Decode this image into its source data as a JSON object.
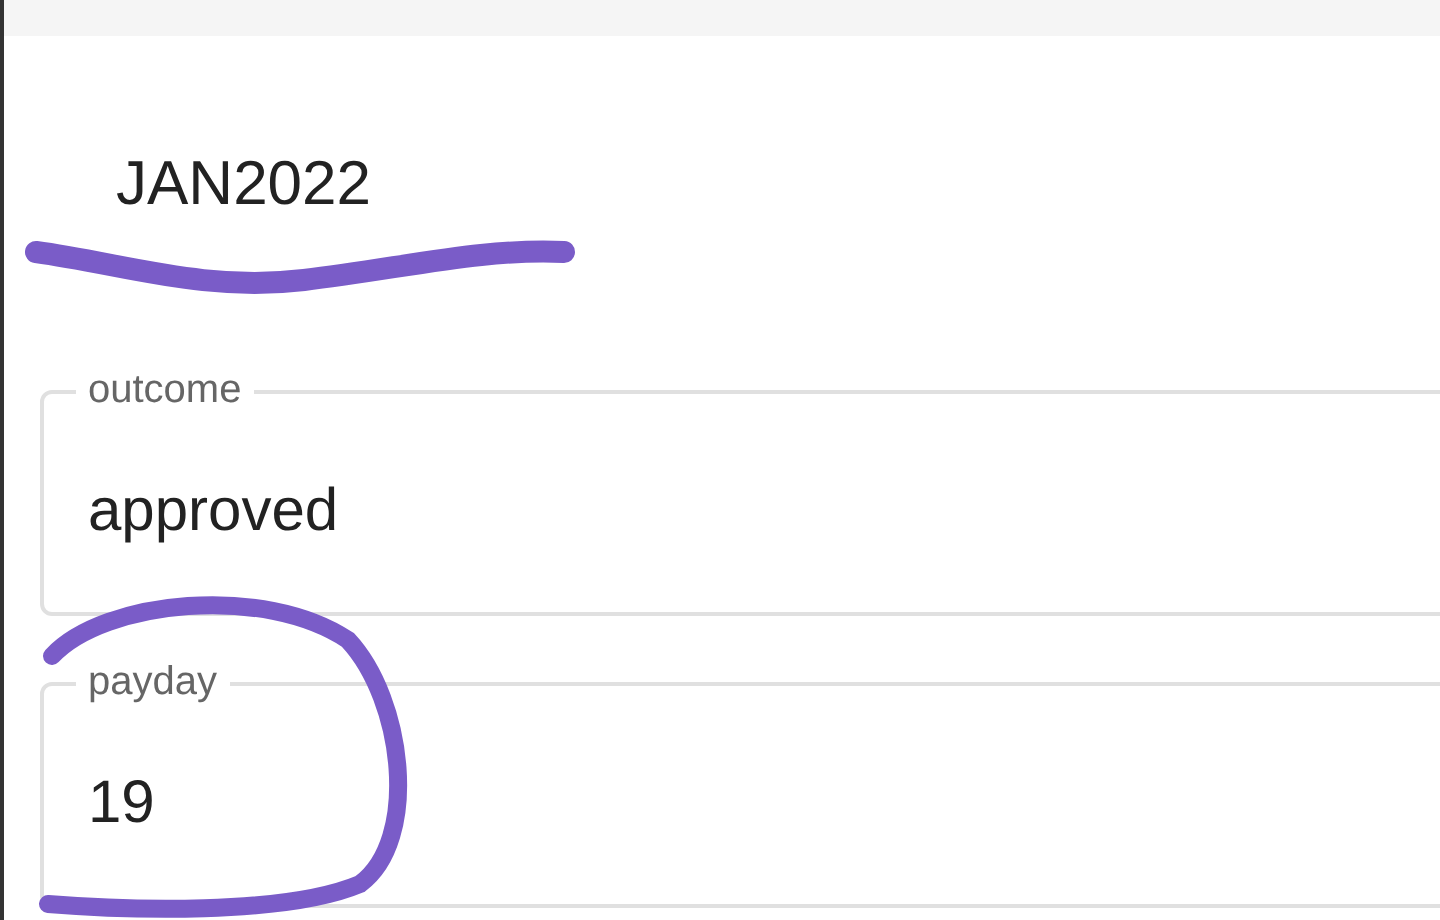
{
  "heading": "JAN2022",
  "fields": [
    {
      "label": "outcome",
      "value": "approved"
    },
    {
      "label": "payday",
      "value": "19"
    }
  ]
}
